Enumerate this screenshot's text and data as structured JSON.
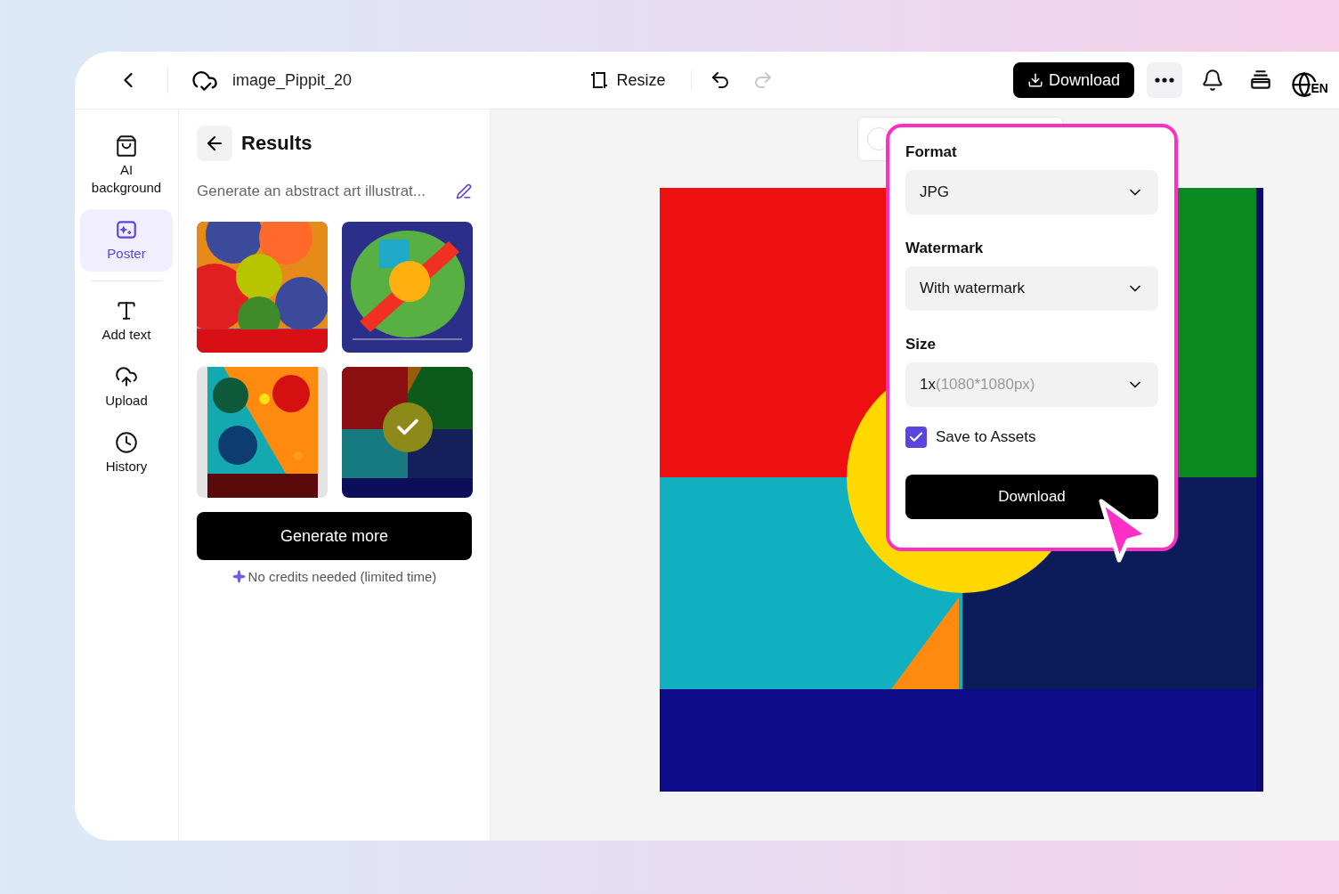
{
  "header": {
    "file_name": "image_Pippit_20",
    "resize": "Resize",
    "download": "Download",
    "language": "EN"
  },
  "rail": [
    {
      "kind": "bag",
      "label": "AI background",
      "selected": false
    },
    {
      "kind": "poster",
      "label": "Poster",
      "selected": true
    },
    {
      "kind": "text",
      "label": "Add text",
      "selected": false
    },
    {
      "kind": "upload",
      "label": "Upload",
      "selected": false
    },
    {
      "kind": "history",
      "label": "History",
      "selected": false
    }
  ],
  "results": {
    "title": "Results",
    "prompt": "Generate an abstract art illustrat...",
    "thumbnails": [
      {
        "selected": false
      },
      {
        "selected": false
      },
      {
        "selected": false
      },
      {
        "selected": true
      }
    ],
    "generate": "Generate more",
    "note": "No credits needed (limited time)"
  },
  "export": {
    "format": {
      "label": "Format",
      "value": "JPG"
    },
    "watermark": {
      "label": "Watermark",
      "value": "With watermark"
    },
    "size": {
      "label": "Size",
      "value": "1x",
      "detail": "(1080*1080px)"
    },
    "save": {
      "label": "Save to Assets",
      "checked": true
    },
    "download": "Download"
  }
}
